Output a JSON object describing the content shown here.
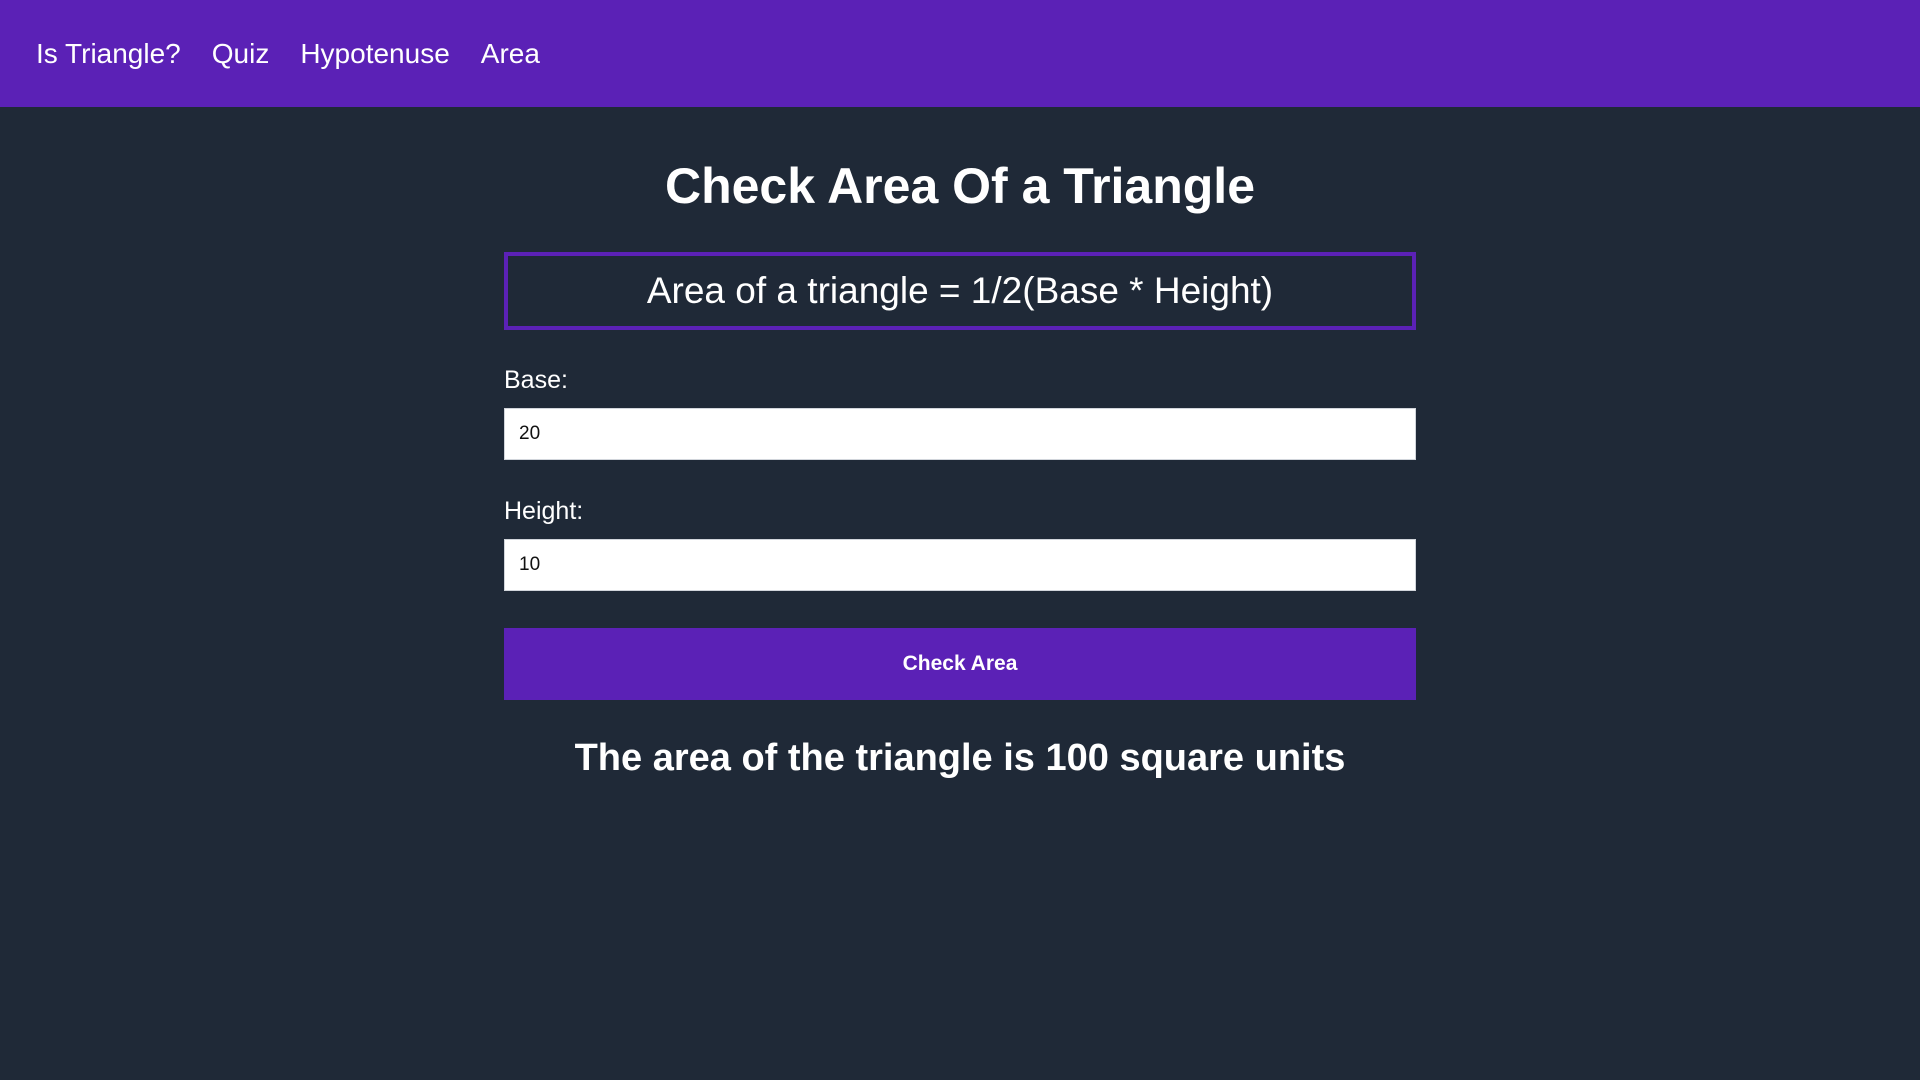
{
  "nav": {
    "items": [
      {
        "label": "Is Triangle?"
      },
      {
        "label": "Quiz"
      },
      {
        "label": "Hypotenuse"
      },
      {
        "label": "Area"
      }
    ]
  },
  "main": {
    "title": "Check Area Of a Triangle",
    "formula": "Area of a triangle = 1/2(Base * Height)",
    "base": {
      "label": "Base:",
      "value": "20"
    },
    "height": {
      "label": "Height:",
      "value": "10"
    },
    "button_label": "Check Area",
    "result": "The area of the triangle is 100 square units"
  },
  "colors": {
    "accent": "#5b21b6",
    "background": "#1f2937",
    "text": "#ffffff"
  }
}
